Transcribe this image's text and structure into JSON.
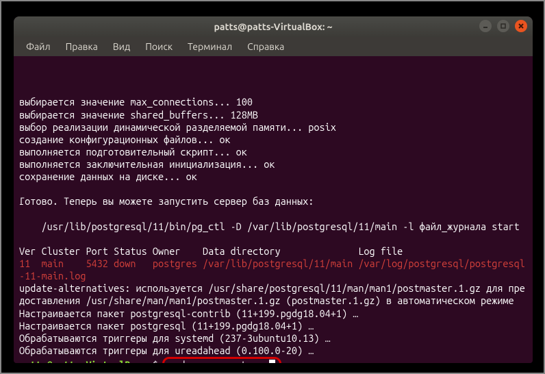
{
  "window": {
    "title": "patts@patts-VirtualBox: ~"
  },
  "menubar": {
    "items": [
      "Файл",
      "Правка",
      "Вид",
      "Поиск",
      "Терминал",
      "Справка"
    ]
  },
  "terminal": {
    "lines": [
      {
        "cls": "white",
        "text": "выбирается значение max_connections... 100"
      },
      {
        "cls": "white",
        "text": "выбирается значение shared_buffers... 128MB"
      },
      {
        "cls": "white",
        "text": "выбор реализации динамической разделяемой памяти... posix"
      },
      {
        "cls": "white",
        "text": "создание конфигурационных файлов... ок"
      },
      {
        "cls": "white",
        "text": "выполняется подготовительный скрипт... ок"
      },
      {
        "cls": "white",
        "text": "выполняется заключительная инициализация... ок"
      },
      {
        "cls": "white",
        "text": "сохранение данных на диске... ок"
      },
      {
        "cls": "white",
        "text": ""
      },
      {
        "cls": "white",
        "text": "Готово. Теперь вы можете запустить сервер баз данных:"
      },
      {
        "cls": "white",
        "text": ""
      },
      {
        "cls": "white",
        "text": "    /usr/lib/postgresql/11/bin/pg_ctl -D /var/lib/postgresql/11/main -l файл_журнала start"
      },
      {
        "cls": "white",
        "text": ""
      },
      {
        "cls": "white",
        "text": "Ver Cluster Port Status Owner    Data directory              Log file"
      },
      {
        "cls": "red",
        "text": "11  main    5432 down   postgres /var/lib/postgresql/11/main /var/log/postgresql/postgresql-11-main.log"
      },
      {
        "cls": "white",
        "text": "update-alternatives: используется /usr/share/postgresql/11/man/man1/postmaster.1.gz для предоставления /usr/share/man/man1/postmaster.1.gz (postmaster.1.gz) в автоматическом режиме"
      },
      {
        "cls": "white",
        "text": "Настраивается пакет postgresql-contrib (11+199.pgdg18.04+1) …"
      },
      {
        "cls": "white",
        "text": "Настраивается пакет postgresql (11+199.pgdg18.04+1) …"
      },
      {
        "cls": "white",
        "text": "Обрабатываются триггеры для systemd (237-3ubuntu10.13) …"
      },
      {
        "cls": "white",
        "text": "Обрабатываются триггеры для ureadahead (0.100.0-20) …"
      }
    ],
    "prompt": {
      "user_host": "patts@patts-VirtualBox",
      "colon": ":",
      "path": "~",
      "dollar": "$",
      "command": "sudo su - postgres"
    }
  }
}
